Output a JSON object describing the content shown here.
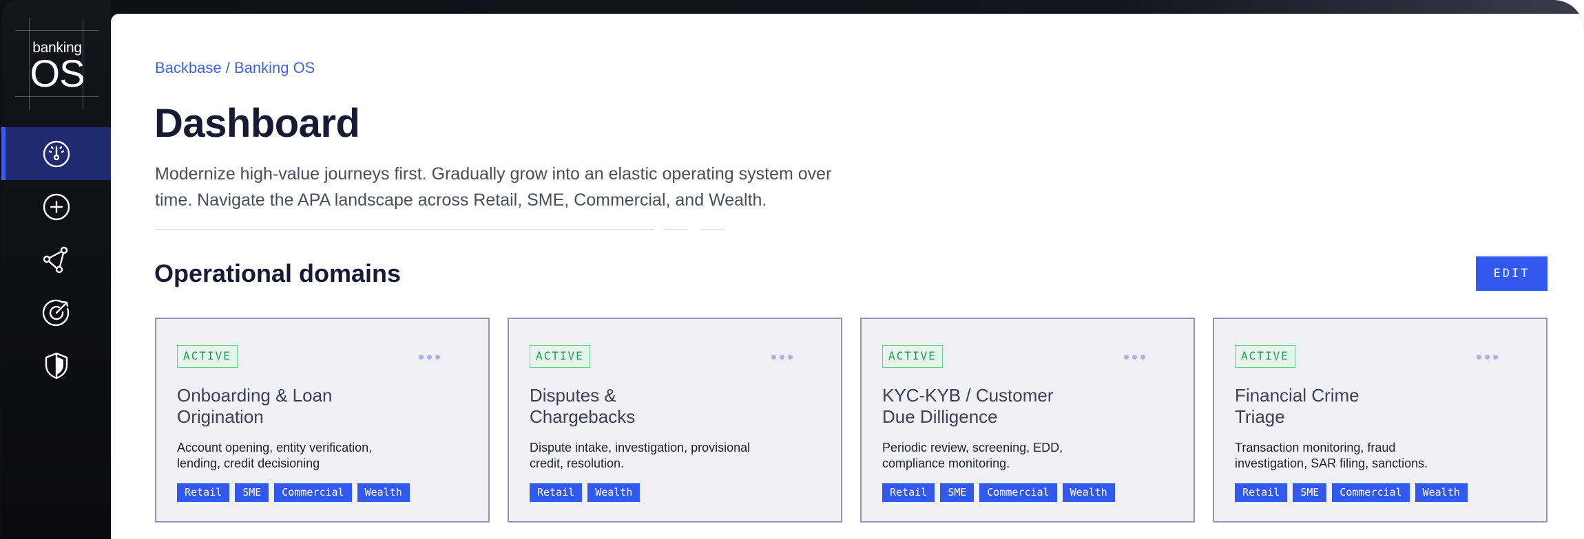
{
  "brand": {
    "top": "banking",
    "bottom": "OS"
  },
  "nav": [
    {
      "icon": "dashboard-gauge-icon",
      "active": true
    },
    {
      "icon": "add-circle-icon",
      "active": false
    },
    {
      "icon": "network-nodes-icon",
      "active": false
    },
    {
      "icon": "target-icon",
      "active": false
    },
    {
      "icon": "shield-icon",
      "active": false
    }
  ],
  "breadcrumb": "Backbase / Banking OS",
  "page_title": "Dashboard",
  "description": "Modernize high-value journeys first. Gradually grow into an elastic operating system over time. Navigate the APA landscape across Retail, SME, Commercial, and Wealth.",
  "section": {
    "title": "Operational domains",
    "edit_label": "EDIT"
  },
  "colors": {
    "accent": "#3358ee",
    "active_green": "#1f9c52",
    "nav_active": "#1f2a70"
  },
  "cards": [
    {
      "status": "ACTIVE",
      "title": "Onboarding & Loan\nOrigination",
      "description": "Account opening, entity verification,\nlending, credit decisioning",
      "tags": [
        "Retail",
        "SME",
        "Commercial",
        "Wealth"
      ]
    },
    {
      "status": "ACTIVE",
      "title": "Disputes &\nChargebacks",
      "description": "Dispute intake, investigation, provisional\ncredit, resolution.",
      "tags": [
        "Retail",
        "Wealth"
      ]
    },
    {
      "status": "ACTIVE",
      "title": "KYC-KYB / Customer\nDue Dilligence",
      "description": "Periodic review, screening, EDD,\ncompliance monitoring.",
      "tags": [
        "Retail",
        "SME",
        "Commercial",
        "Wealth"
      ]
    },
    {
      "status": "ACTIVE",
      "title": "Financial Crime\nTriage",
      "description": "Transaction monitoring, fraud\ninvestigation, SAR filing, sanctions.",
      "tags": [
        "Retail",
        "SME",
        "Commercial",
        "Wealth"
      ]
    }
  ]
}
